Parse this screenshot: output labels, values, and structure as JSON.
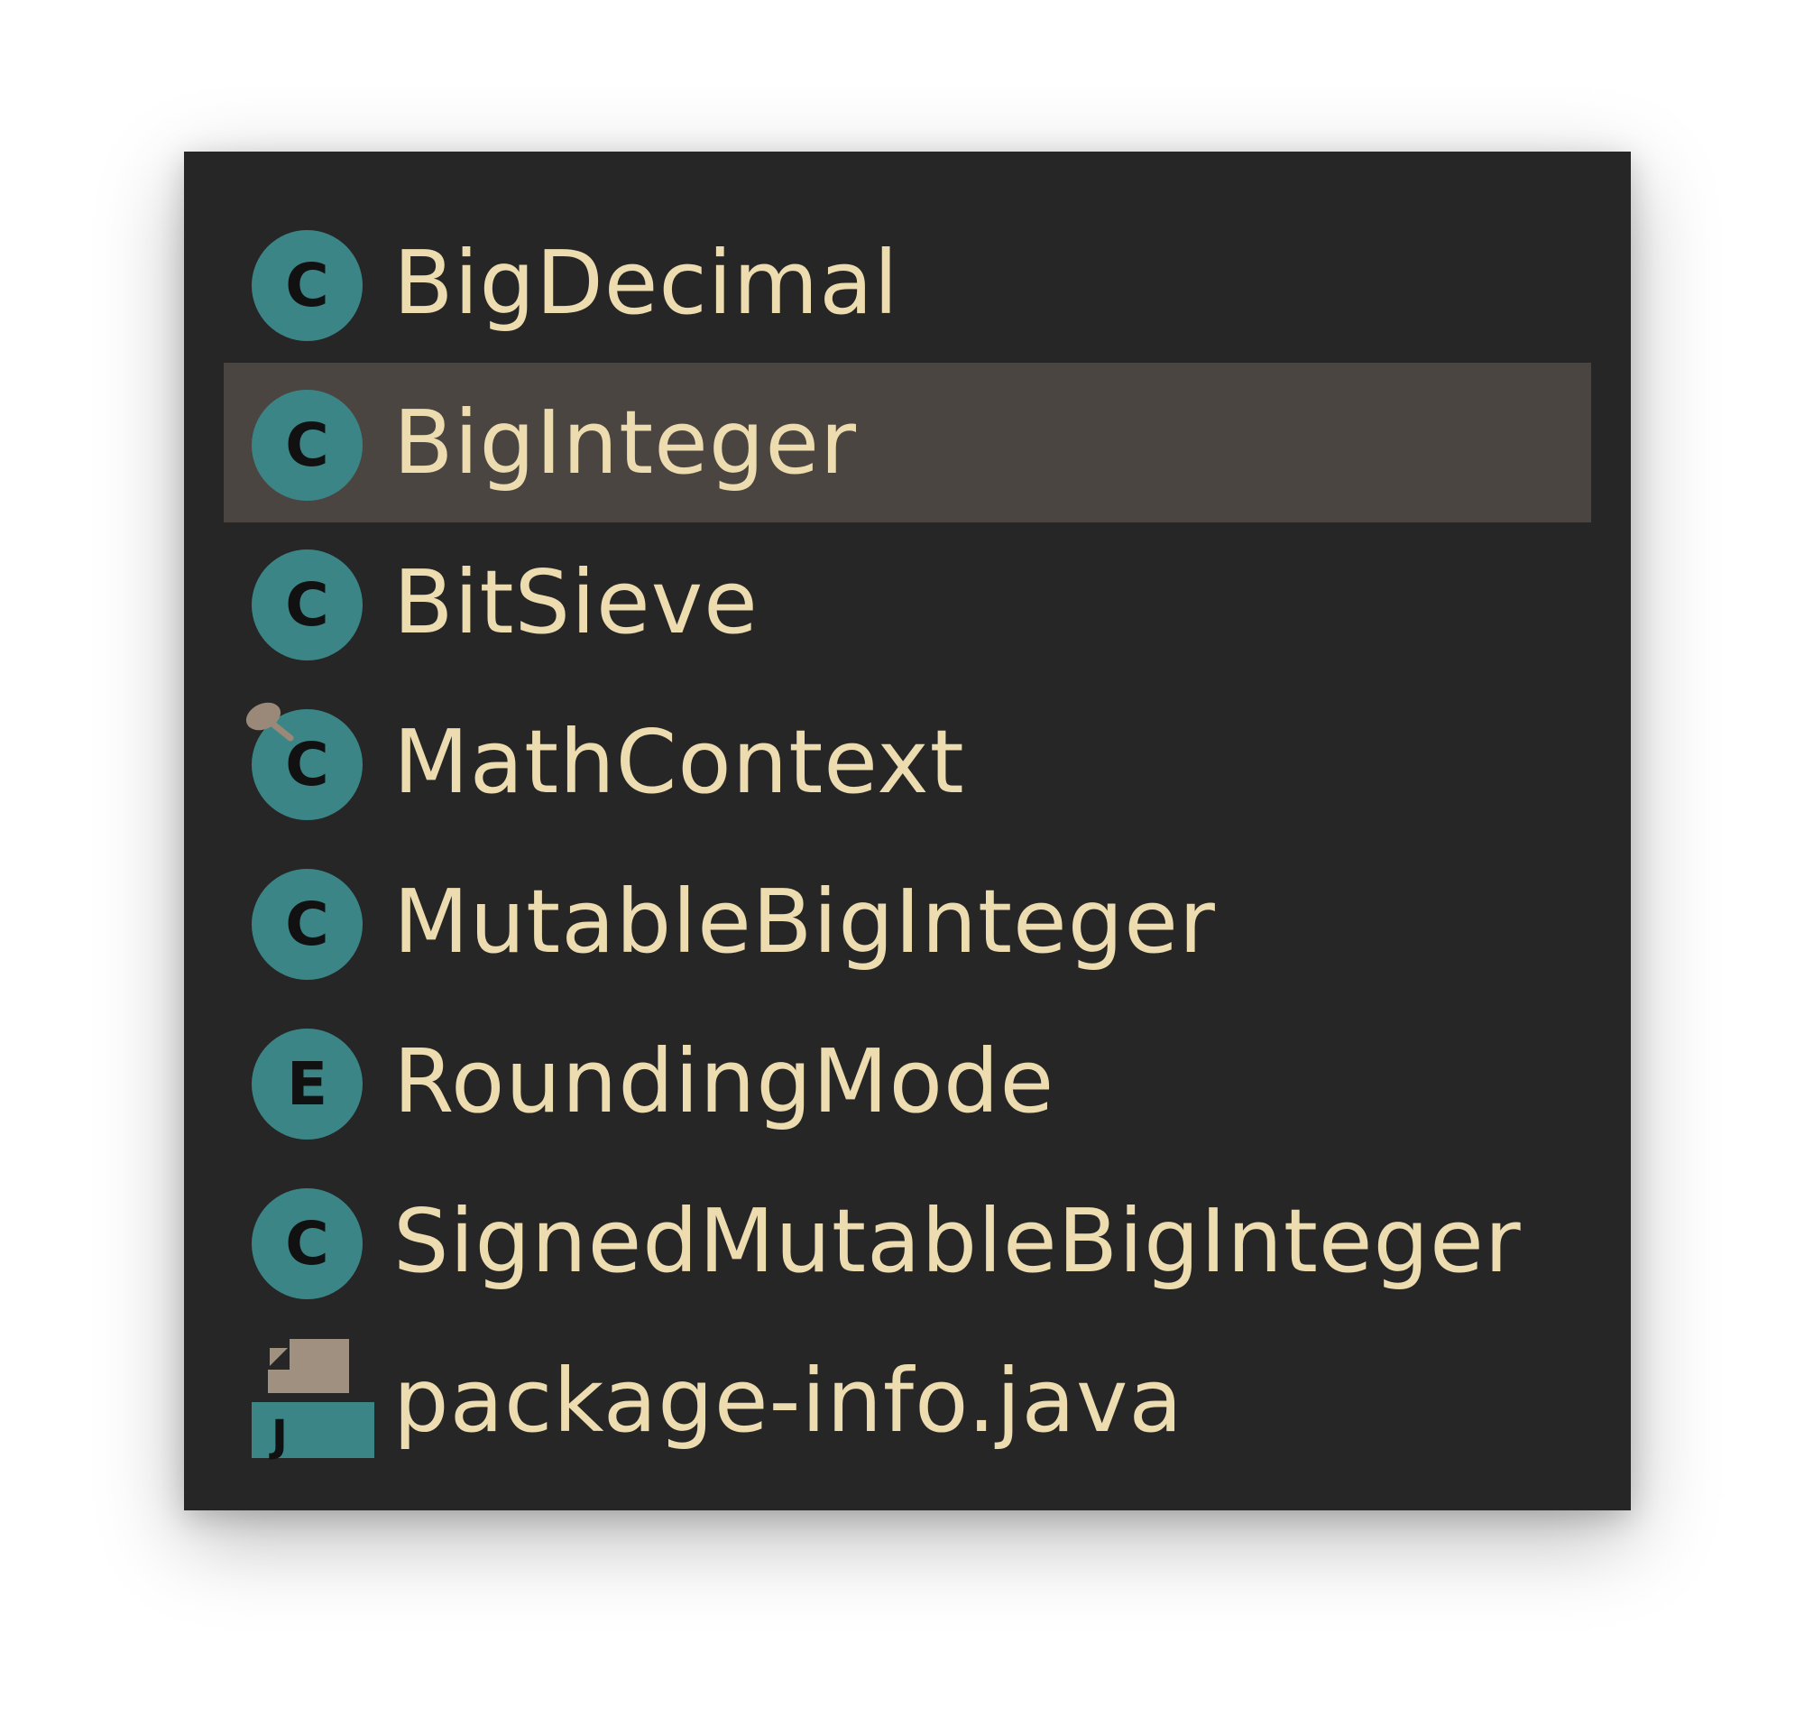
{
  "popup": {
    "items": [
      {
        "label": "BigDecimal",
        "badge": "C",
        "icon": "class-icon"
      },
      {
        "label": "BigInteger",
        "badge": "C",
        "icon": "class-icon",
        "selected": true
      },
      {
        "label": "BitSieve",
        "badge": "C",
        "icon": "class-icon"
      },
      {
        "label": "MathContext",
        "badge": "C",
        "icon": "final-class-icon"
      },
      {
        "label": "MutableBigInteger",
        "badge": "C",
        "icon": "class-icon"
      },
      {
        "label": "RoundingMode",
        "badge": "E",
        "icon": "enum-icon"
      },
      {
        "label": "SignedMutableBigInteger",
        "badge": "C",
        "icon": "class-icon"
      },
      {
        "label": "package-info.java",
        "badge": "J",
        "icon": "java-file-icon"
      }
    ]
  },
  "colors": {
    "background": "#262626",
    "selection": "#4b4541",
    "text": "#ecdcb0",
    "icon_teal": "#3c8587",
    "icon_gray": "#a09080"
  }
}
